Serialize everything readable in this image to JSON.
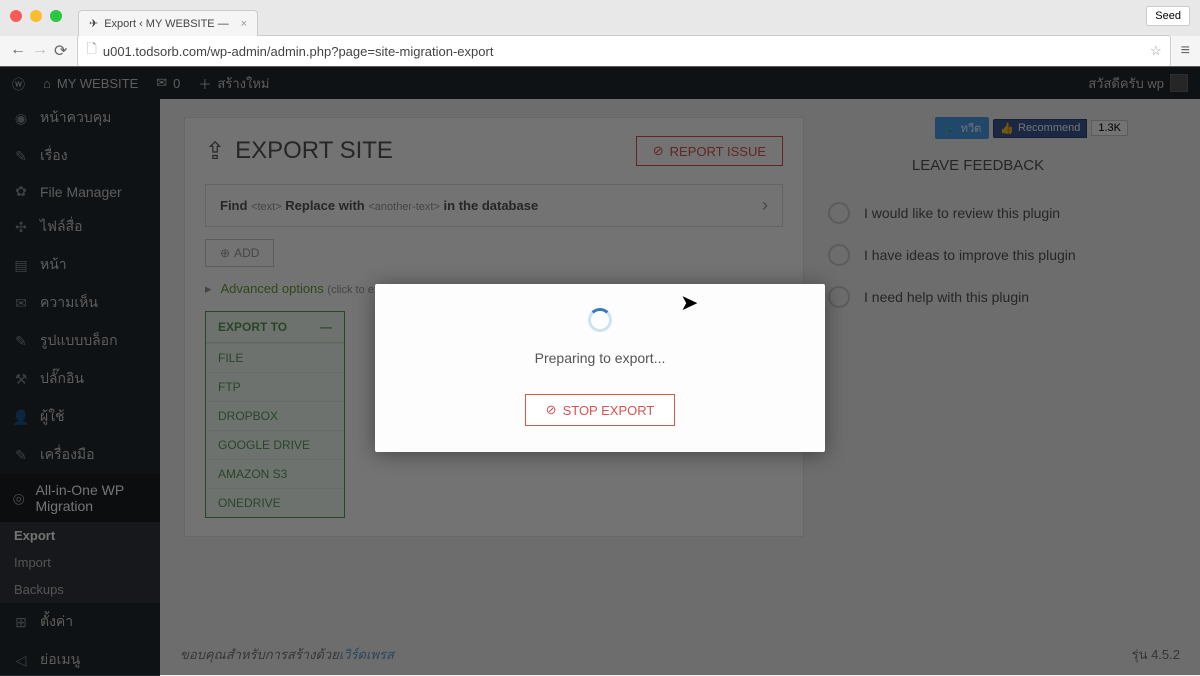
{
  "browser": {
    "tab_title": "Export ‹ MY WEBSITE —",
    "seed_label": "Seed",
    "url": "u001.todsorb.com/wp-admin/admin.php?page=site-migration-export"
  },
  "adminbar": {
    "site_name": "MY WEBSITE",
    "comments": "0",
    "new_label": "สร้างใหม่",
    "greeting": "สวัสดีครับ wp"
  },
  "sidebar": {
    "items": [
      {
        "icon": "◉",
        "label": "หน้าควบคุม"
      },
      {
        "icon": "✎",
        "label": "เรื่อง"
      },
      {
        "icon": "✿",
        "label": "File Manager"
      },
      {
        "icon": "✣",
        "label": "ไฟล์สื่อ"
      },
      {
        "icon": "▤",
        "label": "หน้า"
      },
      {
        "icon": "✉",
        "label": "ความเห็น"
      },
      {
        "icon": "✎",
        "label": "รูปแบบบล็อก"
      },
      {
        "icon": "⚒",
        "label": "ปลั๊กอิน"
      },
      {
        "icon": "👤",
        "label": "ผู้ใช้"
      },
      {
        "icon": "✎",
        "label": "เครื่องมือ"
      },
      {
        "icon": "◎",
        "label": "All-in-One WP Migration"
      }
    ],
    "submenu": [
      "Export",
      "Import",
      "Backups"
    ],
    "tail": [
      {
        "icon": "⊞",
        "label": "ตั้งค่า"
      },
      {
        "icon": "◁",
        "label": "ย่อเมนู"
      }
    ]
  },
  "main": {
    "title": "EXPORT SITE",
    "report_issue": "REPORT ISSUE",
    "find_label": "Find",
    "find_ph": "<text>",
    "replace_label": "Replace with",
    "replace_ph": "<another-text>",
    "find_suffix": "in the database",
    "add_label": "ADD",
    "advanced_label": "Advanced options",
    "advanced_hint": "(click to exp",
    "export_to": "EXPORT TO",
    "export_options": [
      "FILE",
      "FTP",
      "DROPBOX",
      "GOOGLE DRIVE",
      "AMAZON S3",
      "ONEDRIVE"
    ]
  },
  "feedback": {
    "tweet": "ทวีต",
    "recommend": "Recommend",
    "count": "1.3K",
    "title": "LEAVE FEEDBACK",
    "options": [
      "I would like to review this plugin",
      "I have ideas to improve this plugin",
      "I need help with this plugin"
    ]
  },
  "modal": {
    "status": "Preparing to export...",
    "stop_label": "STOP EXPORT"
  },
  "footer": {
    "thanks": "ขอบคุณสำหรับการสร้างด้วย",
    "link": "เวิร์ดเพรส",
    "version": "รุ่น 4.5.2"
  }
}
